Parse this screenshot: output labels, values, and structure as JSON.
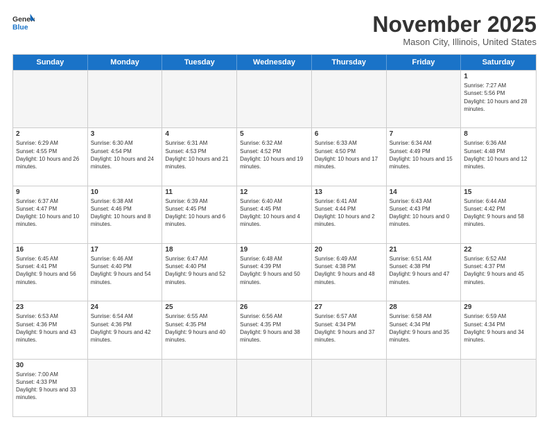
{
  "header": {
    "logo_general": "General",
    "logo_blue": "Blue",
    "month_title": "November 2025",
    "location": "Mason City, Illinois, United States"
  },
  "days_of_week": [
    "Sunday",
    "Monday",
    "Tuesday",
    "Wednesday",
    "Thursday",
    "Friday",
    "Saturday"
  ],
  "weeks": [
    [
      {
        "day": "",
        "empty": true
      },
      {
        "day": "",
        "empty": true
      },
      {
        "day": "",
        "empty": true
      },
      {
        "day": "",
        "empty": true
      },
      {
        "day": "",
        "empty": true
      },
      {
        "day": "",
        "empty": true
      },
      {
        "day": "1",
        "sunrise": "Sunrise: 7:27 AM",
        "sunset": "Sunset: 5:56 PM",
        "daylight": "Daylight: 10 hours and 28 minutes."
      }
    ],
    [
      {
        "day": "2",
        "sunrise": "Sunrise: 6:29 AM",
        "sunset": "Sunset: 4:55 PM",
        "daylight": "Daylight: 10 hours and 26 minutes."
      },
      {
        "day": "3",
        "sunrise": "Sunrise: 6:30 AM",
        "sunset": "Sunset: 4:54 PM",
        "daylight": "Daylight: 10 hours and 24 minutes."
      },
      {
        "day": "4",
        "sunrise": "Sunrise: 6:31 AM",
        "sunset": "Sunset: 4:53 PM",
        "daylight": "Daylight: 10 hours and 21 minutes."
      },
      {
        "day": "5",
        "sunrise": "Sunrise: 6:32 AM",
        "sunset": "Sunset: 4:52 PM",
        "daylight": "Daylight: 10 hours and 19 minutes."
      },
      {
        "day": "6",
        "sunrise": "Sunrise: 6:33 AM",
        "sunset": "Sunset: 4:50 PM",
        "daylight": "Daylight: 10 hours and 17 minutes."
      },
      {
        "day": "7",
        "sunrise": "Sunrise: 6:34 AM",
        "sunset": "Sunset: 4:49 PM",
        "daylight": "Daylight: 10 hours and 15 minutes."
      },
      {
        "day": "8",
        "sunrise": "Sunrise: 6:36 AM",
        "sunset": "Sunset: 4:48 PM",
        "daylight": "Daylight: 10 hours and 12 minutes."
      }
    ],
    [
      {
        "day": "9",
        "sunrise": "Sunrise: 6:37 AM",
        "sunset": "Sunset: 4:47 PM",
        "daylight": "Daylight: 10 hours and 10 minutes."
      },
      {
        "day": "10",
        "sunrise": "Sunrise: 6:38 AM",
        "sunset": "Sunset: 4:46 PM",
        "daylight": "Daylight: 10 hours and 8 minutes."
      },
      {
        "day": "11",
        "sunrise": "Sunrise: 6:39 AM",
        "sunset": "Sunset: 4:45 PM",
        "daylight": "Daylight: 10 hours and 6 minutes."
      },
      {
        "day": "12",
        "sunrise": "Sunrise: 6:40 AM",
        "sunset": "Sunset: 4:45 PM",
        "daylight": "Daylight: 10 hours and 4 minutes."
      },
      {
        "day": "13",
        "sunrise": "Sunrise: 6:41 AM",
        "sunset": "Sunset: 4:44 PM",
        "daylight": "Daylight: 10 hours and 2 minutes."
      },
      {
        "day": "14",
        "sunrise": "Sunrise: 6:43 AM",
        "sunset": "Sunset: 4:43 PM",
        "daylight": "Daylight: 10 hours and 0 minutes."
      },
      {
        "day": "15",
        "sunrise": "Sunrise: 6:44 AM",
        "sunset": "Sunset: 4:42 PM",
        "daylight": "Daylight: 9 hours and 58 minutes."
      }
    ],
    [
      {
        "day": "16",
        "sunrise": "Sunrise: 6:45 AM",
        "sunset": "Sunset: 4:41 PM",
        "daylight": "Daylight: 9 hours and 56 minutes."
      },
      {
        "day": "17",
        "sunrise": "Sunrise: 6:46 AM",
        "sunset": "Sunset: 4:40 PM",
        "daylight": "Daylight: 9 hours and 54 minutes."
      },
      {
        "day": "18",
        "sunrise": "Sunrise: 6:47 AM",
        "sunset": "Sunset: 4:40 PM",
        "daylight": "Daylight: 9 hours and 52 minutes."
      },
      {
        "day": "19",
        "sunrise": "Sunrise: 6:48 AM",
        "sunset": "Sunset: 4:39 PM",
        "daylight": "Daylight: 9 hours and 50 minutes."
      },
      {
        "day": "20",
        "sunrise": "Sunrise: 6:49 AM",
        "sunset": "Sunset: 4:38 PM",
        "daylight": "Daylight: 9 hours and 48 minutes."
      },
      {
        "day": "21",
        "sunrise": "Sunrise: 6:51 AM",
        "sunset": "Sunset: 4:38 PM",
        "daylight": "Daylight: 9 hours and 47 minutes."
      },
      {
        "day": "22",
        "sunrise": "Sunrise: 6:52 AM",
        "sunset": "Sunset: 4:37 PM",
        "daylight": "Daylight: 9 hours and 45 minutes."
      }
    ],
    [
      {
        "day": "23",
        "sunrise": "Sunrise: 6:53 AM",
        "sunset": "Sunset: 4:36 PM",
        "daylight": "Daylight: 9 hours and 43 minutes."
      },
      {
        "day": "24",
        "sunrise": "Sunrise: 6:54 AM",
        "sunset": "Sunset: 4:36 PM",
        "daylight": "Daylight: 9 hours and 42 minutes."
      },
      {
        "day": "25",
        "sunrise": "Sunrise: 6:55 AM",
        "sunset": "Sunset: 4:35 PM",
        "daylight": "Daylight: 9 hours and 40 minutes."
      },
      {
        "day": "26",
        "sunrise": "Sunrise: 6:56 AM",
        "sunset": "Sunset: 4:35 PM",
        "daylight": "Daylight: 9 hours and 38 minutes."
      },
      {
        "day": "27",
        "sunrise": "Sunrise: 6:57 AM",
        "sunset": "Sunset: 4:34 PM",
        "daylight": "Daylight: 9 hours and 37 minutes."
      },
      {
        "day": "28",
        "sunrise": "Sunrise: 6:58 AM",
        "sunset": "Sunset: 4:34 PM",
        "daylight": "Daylight: 9 hours and 35 minutes."
      },
      {
        "day": "29",
        "sunrise": "Sunrise: 6:59 AM",
        "sunset": "Sunset: 4:34 PM",
        "daylight": "Daylight: 9 hours and 34 minutes."
      }
    ],
    [
      {
        "day": "30",
        "sunrise": "Sunrise: 7:00 AM",
        "sunset": "Sunset: 4:33 PM",
        "daylight": "Daylight: 9 hours and 33 minutes."
      },
      {
        "day": "",
        "empty": true
      },
      {
        "day": "",
        "empty": true
      },
      {
        "day": "",
        "empty": true
      },
      {
        "day": "",
        "empty": true
      },
      {
        "day": "",
        "empty": true
      },
      {
        "day": "",
        "empty": true
      }
    ]
  ]
}
